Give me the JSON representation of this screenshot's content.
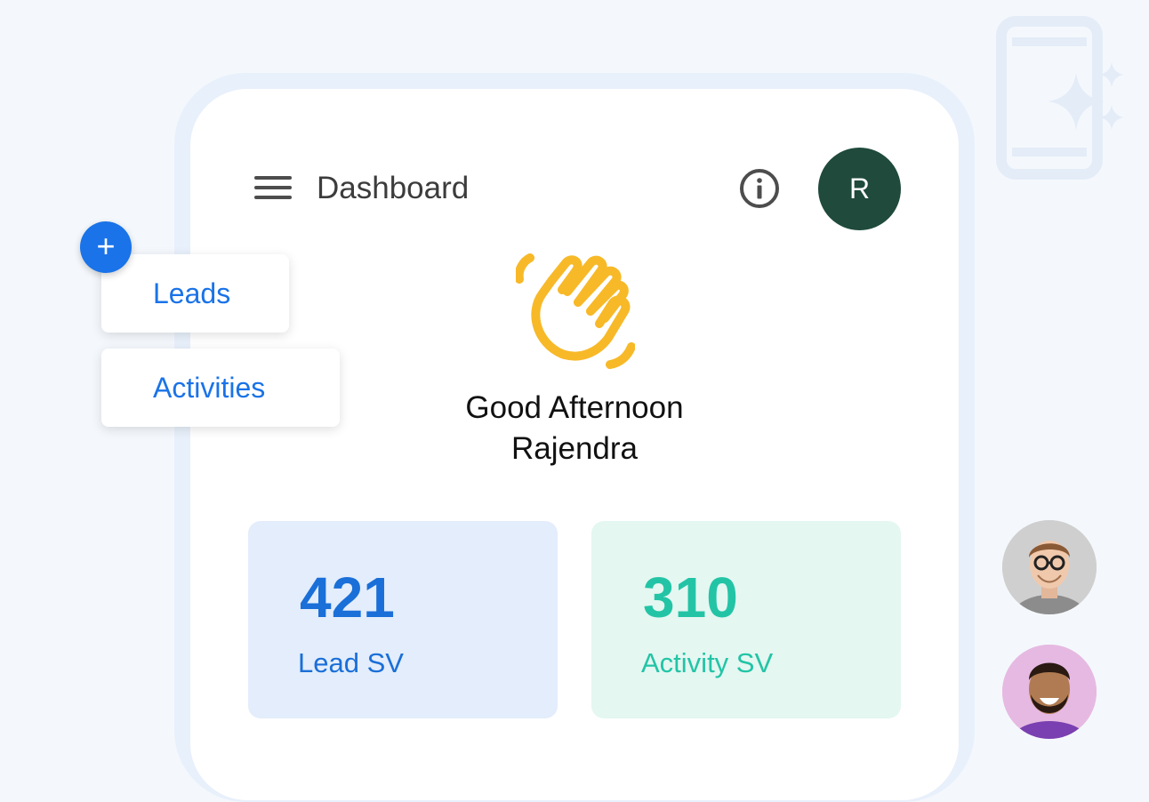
{
  "header": {
    "title": "Dashboard",
    "menu_icon": "hamburger-menu-icon",
    "info_icon": "info-icon",
    "avatar_initial": "R"
  },
  "quick_actions": {
    "fab_icon": "plus-icon",
    "fab_label": "+",
    "items": [
      {
        "label": "Leads"
      },
      {
        "label": "Activities"
      }
    ]
  },
  "greeting": {
    "icon": "waving-hand-icon",
    "line1": "Good Afternoon",
    "line2": "Rajendra"
  },
  "stats": [
    {
      "value": "421",
      "label": "Lead SV"
    },
    {
      "value": "310",
      "label": "Activity SV"
    }
  ],
  "colors": {
    "primary_blue": "#1a73e8",
    "avatar_green": "#1f4a3c",
    "wave_yellow": "#f7b928",
    "activity_teal": "#23c4a6",
    "lead_card_bg": "#e3edfb",
    "activity_card_bg": "#e4f7f1"
  }
}
